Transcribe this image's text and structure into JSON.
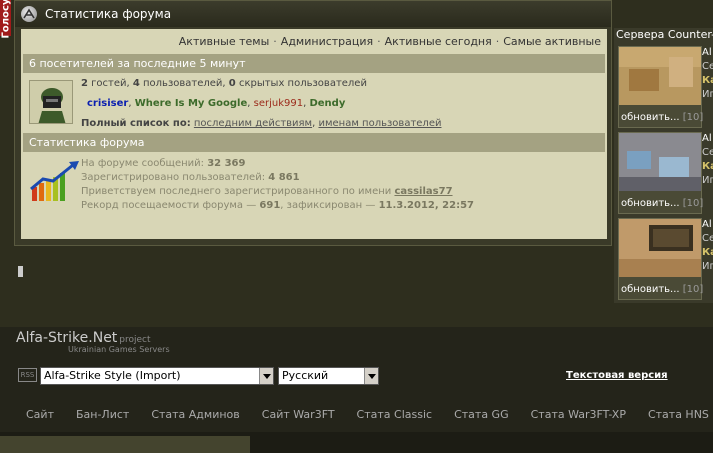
{
  "vote_tab": {
    "label": "Голосу"
  },
  "window": {
    "title": "Статистика форума"
  },
  "top_links": [
    {
      "label": "Активные темы"
    },
    {
      "label": "Администрация"
    },
    {
      "label": "Активные сегодня"
    },
    {
      "label": "Самые активные"
    }
  ],
  "visitors": {
    "header": "6 посетителей за последние 5 минут",
    "summary_parts": {
      "guests_n": "2",
      "guests": " гостей, ",
      "users_n": "4",
      "users": " пользователей, ",
      "hidden_n": "0",
      "hidden": " скрытых пользователей"
    },
    "users": [
      {
        "name": "crisiser"
      },
      {
        "name": "Where Is My Google"
      },
      {
        "name": "serjuk991"
      },
      {
        "name": "Dendy"
      }
    ],
    "full_list_label": "Полный список по:",
    "full_list_link1": "последним действиям",
    "full_list_link2": "именам пользователей"
  },
  "forum_stats": {
    "header": "Статистика форума",
    "messages_label": "На форуме сообщений:",
    "messages_value": "32 369",
    "registered_label": "Зарегистрировано пользователей:",
    "registered_value": "4 861",
    "latest_label": "Приветствуем последнего зарегистрированного по имени",
    "latest_user": "cassilas77",
    "record_label": "Рекорд посещаемости форума —",
    "record_value": "691",
    "record_mid": ", зафиксирован —",
    "record_date": "11.3.2012, 22:57"
  },
  "servers": {
    "header": "Сервера Counter-St",
    "refresh_label": "обновить...",
    "refresh_count": "[10]",
    "side_a": "Al",
    "side_s": "Се",
    "side_k": "Ка",
    "side_i": "Иг"
  },
  "footer": {
    "brand": "Alfa-Strike.Net",
    "brand_small": "project",
    "subtitle": "Ukrainian Games Servers",
    "rss": "RSS",
    "style_select": "Alfa-Strike Style (Import)",
    "lang_select": "Русский",
    "text_version": "Текстовая версия",
    "nav": [
      {
        "label": "Сайт"
      },
      {
        "label": "Бан-Лист"
      },
      {
        "label": "Стата Админов"
      },
      {
        "label": "Сайт War3FT"
      },
      {
        "label": "Стата Classic"
      },
      {
        "label": "Стата GG"
      },
      {
        "label": "Стата War3FT-XP"
      },
      {
        "label": "Стата HNS"
      }
    ]
  },
  "colors": {
    "accent": "#a4a282",
    "content_bg": "#d8d6b6",
    "vote_tab": "#a01a1a"
  }
}
